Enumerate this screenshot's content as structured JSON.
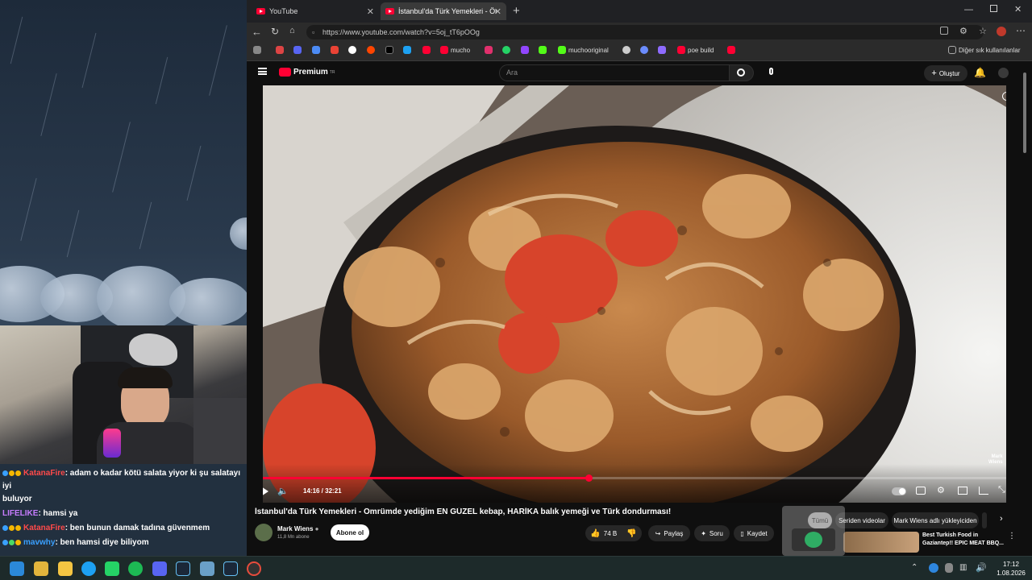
{
  "browser": {
    "tabs": [
      {
        "title": "YouTube"
      },
      {
        "title": "İstanbul'da Türk Yemekleri - Ömrü"
      }
    ],
    "url": "https://www.youtube.com/watch?v=5oj_tT6pOOg",
    "url_host": "www.youtube.com",
    "bookmarks": [
      {
        "label": "mucho"
      },
      {
        "label": "muchooriginal"
      },
      {
        "label": "poe build"
      }
    ],
    "other_bookmarks": "Diğer sık kullanılanlar"
  },
  "youtube": {
    "logo": "Premium",
    "logo_sup": "TR",
    "search_placeholder": "Ara",
    "create_label": "Oluştur",
    "player": {
      "time": "14:16 / 32:21",
      "progress": 0.441,
      "watermark": "Mark\nWiens"
    },
    "video_title": "İstanbul'da Türk Yemekleri - Ömrümde yediğim EN GÜZEL kebap, HARİKA balık yemeği ve Türk dondurması!",
    "channel": {
      "name": "Mark Wiens",
      "subscribers": "11,8 Mn abone",
      "subscribe_label": "Abone ol"
    },
    "actions": {
      "likes": "74 B",
      "share": "Paylaş",
      "ask": "Soru",
      "save": "Kaydet"
    },
    "filters": [
      "Tümü",
      "Seriden videolar",
      "Mark Wiens adlı yükleyiciden"
    ],
    "recommended": {
      "title_line1": "Best Turkish Food in",
      "title_line2": "Gaziantep!! EPIC MEAT BBQ..."
    }
  },
  "chat": [
    {
      "user": "KatanaFire",
      "msg": ": adam o kadar kötü salata yiyor ki şu salatayı iyi",
      "cont": "buluyor",
      "color": "#ff4a4a"
    },
    {
      "user": "LIFELIKE",
      "msg": ": hamsi ya",
      "color": "#c77dff"
    },
    {
      "user": "KatanaFire",
      "msg": ": ben bunun damak tadına güvenmem",
      "color": "#ff4a4a"
    },
    {
      "user": "mavwhy",
      "msg": ": ben hamsi diye biliyom",
      "color": "#3aa0ff"
    }
  ],
  "taskbar": {
    "time": "17:12",
    "date": "1.08.2026"
  },
  "colors": {
    "yt_red": "#ff0033",
    "bg": "#0f0f0f",
    "chip": "#272727"
  }
}
